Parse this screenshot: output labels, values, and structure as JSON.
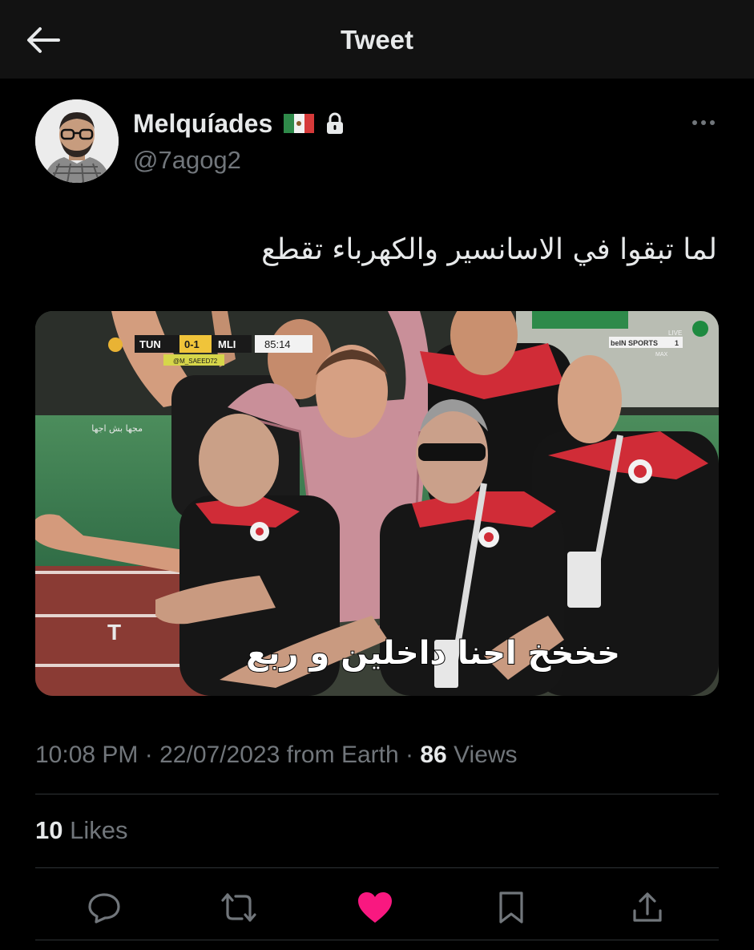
{
  "header": {
    "title": "Tweet"
  },
  "author": {
    "name": "Melquíades",
    "handle": "@7agog2"
  },
  "tweet": {
    "text": "لما تبقوا في الاسانسير والكهرباء تقطع",
    "time": "10:08 PM",
    "date": "22/07/2023",
    "source": "from Earth",
    "views_count": "86",
    "views_label": "Views",
    "likes_count": "10",
    "likes_label": "Likes",
    "liked": true
  },
  "media": {
    "score_home": "TUN",
    "score": "0-1",
    "score_away": "MLI",
    "clock": "85:14",
    "broadcaster": "beIN SPORTS",
    "broadcaster_channel": "1",
    "live_label": "LIVE",
    "max_label": "MAX",
    "source_handle": "@M_SAEED72",
    "watermark": "مجها بش اجها",
    "subtitle": "خخخخ احنا داخلين و ربع"
  },
  "colors": {
    "like": "#f91880",
    "muted": "#71767b",
    "text": "#e7e9ea",
    "background": "#000000",
    "header_bg": "#121212"
  },
  "icons": [
    "back-arrow-icon",
    "lock-icon",
    "more-icon",
    "reply-icon",
    "retweet-icon",
    "like-icon",
    "bookmark-icon",
    "share-icon"
  ]
}
